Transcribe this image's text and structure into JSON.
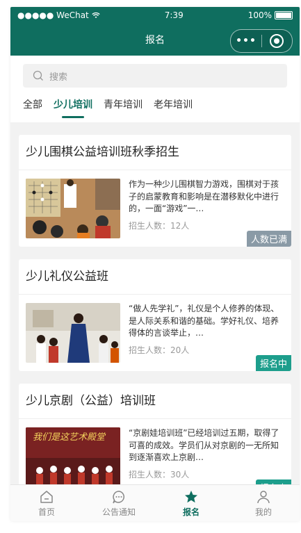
{
  "status_bar": {
    "carrier": "●●●●● WeChat",
    "time": "7:39",
    "battery": "100%"
  },
  "navbar": {
    "title": "报名",
    "menu_icon": "more-dots-icon",
    "close_icon": "target-icon"
  },
  "search": {
    "placeholder": "搜索"
  },
  "tabs": [
    {
      "label": "全部"
    },
    {
      "label": "少儿培训",
      "active": true
    },
    {
      "label": "青年培训"
    },
    {
      "label": "老年培训"
    }
  ],
  "cards": [
    {
      "title": "少儿围棋公益培训班秋季招生",
      "desc": "作为一种少儿围棋智力游戏，围棋对于孩子的启蒙教育和影响是在潜移默化中进行的，一面“游戏”一…",
      "count": "招生人数：12人",
      "badge": "人数已满",
      "badge_color": "#8a9aa6"
    },
    {
      "title": "少儿礼仪公益班",
      "desc": "“做人先学礼”，礼仪是个人修养的体现、是人际关系和谐的基础。学好礼仪、培养得体的言谈举止，…",
      "count": "招生人数：20人",
      "badge": "报名中",
      "badge_color": "#1d9e8c"
    },
    {
      "title": "少儿京剧（公益）培训班",
      "desc": "“京剧娃培训班”已经培训过五期，取得了可喜的成效。学员们从对京剧的一无所知到逐渐喜欢上京剧…",
      "count": "招生人数：30人",
      "badge": "报名中",
      "badge_color": "#1d9e8c",
      "thumb_text": "我们是这艺术殿堂"
    }
  ],
  "tabbar": [
    {
      "label": "首页",
      "icon": "home-icon"
    },
    {
      "label": "公告通知",
      "icon": "message-icon"
    },
    {
      "label": "报名",
      "icon": "star-icon",
      "active": true
    },
    {
      "label": "我的",
      "icon": "user-icon"
    }
  ],
  "colors": {
    "primary": "#0f6e5f",
    "badge_full": "#8a9aa6",
    "badge_open": "#1d9e8c"
  }
}
